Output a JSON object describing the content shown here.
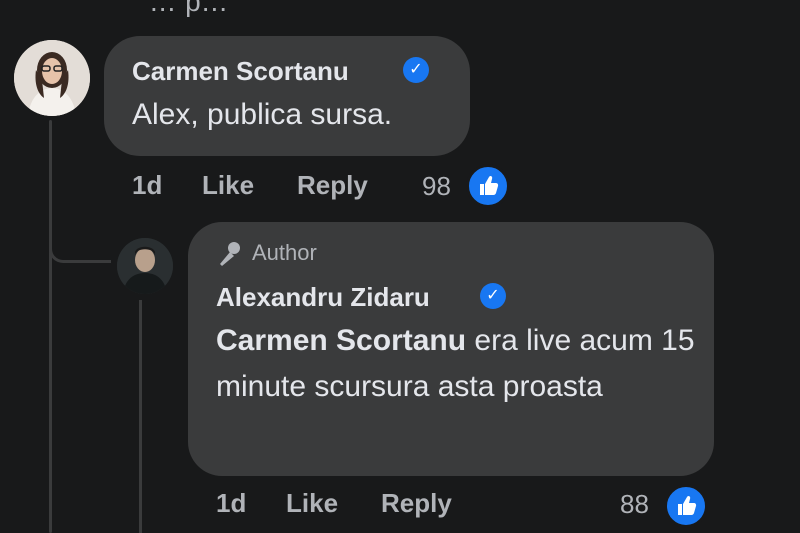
{
  "cutoff_text": "... p...",
  "comments": [
    {
      "author": "Carmen Scortanu",
      "text": "Alex, publica sursa.",
      "time": "1d",
      "like_label": "Like",
      "reply_label": "Reply",
      "reaction_count": "98"
    },
    {
      "badge": "Author",
      "author": "Alexandru Zidaru",
      "mention": "Carmen Scortanu",
      "text": " era live acum 15 minute scursura asta proasta",
      "time": "1d",
      "like_label": "Like",
      "reply_label": "Reply",
      "reaction_count": "88"
    }
  ],
  "colors": {
    "background": "#18191a",
    "bubble": "#3a3b3c",
    "accent": "#1877f2",
    "secondary_text": "#b0b3b8"
  }
}
